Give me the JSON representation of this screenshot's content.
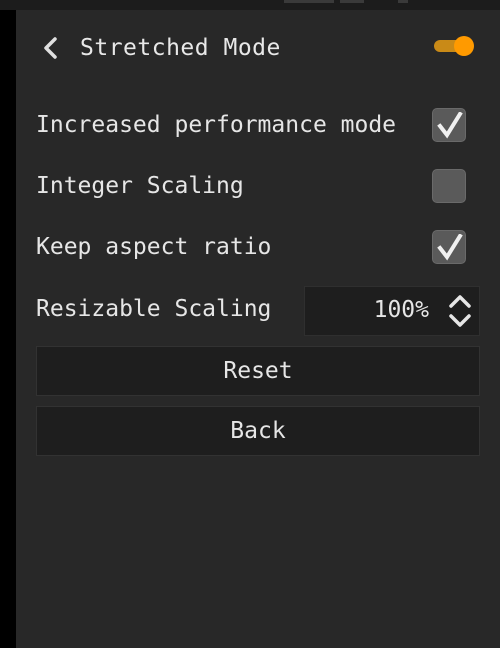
{
  "header": {
    "title": "Stretched Mode",
    "back_icon": "chevron-left-icon",
    "toggle_on": true,
    "accent_color": "#ff9a00"
  },
  "options": [
    {
      "label": "Increased performance mode",
      "checked": true
    },
    {
      "label": "Integer Scaling",
      "checked": false
    },
    {
      "label": "Keep aspect ratio",
      "checked": true
    }
  ],
  "scaling": {
    "label": "Resizable Scaling",
    "value": "100%",
    "arrows_icon": "up-down-arrows-icon"
  },
  "buttons": {
    "reset_label": "Reset",
    "back_label": "Back"
  }
}
